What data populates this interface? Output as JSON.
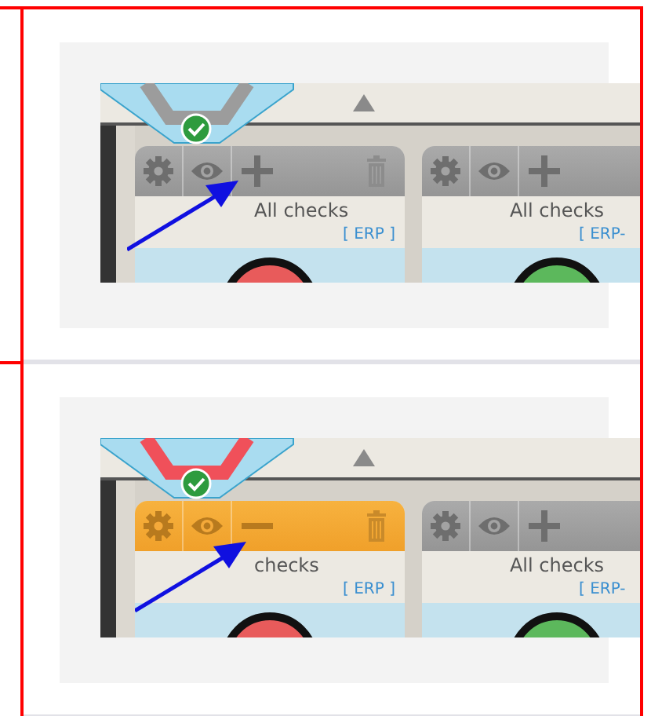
{
  "panels": [
    {
      "alert": false,
      "cards": [
        {
          "title": "All checks",
          "tag": "[ ERP ]",
          "highlighted": false,
          "kind": "plus",
          "deletable": true,
          "color": "#e85b5b"
        },
        {
          "title": "All checks",
          "tag": "[ ERP-",
          "highlighted": false,
          "kind": "plus",
          "color": "#5cb85c"
        }
      ]
    },
    {
      "alert": true,
      "cards": [
        {
          "title": "checks",
          "tag": "[ ERP ]",
          "highlighted": true,
          "kind": "minus",
          "deletable": true,
          "color": "#e85b5b"
        },
        {
          "title": "All checks",
          "tag": "[ ERP-",
          "highlighted": false,
          "kind": "plus",
          "color": "#5cb85c"
        }
      ]
    }
  ]
}
